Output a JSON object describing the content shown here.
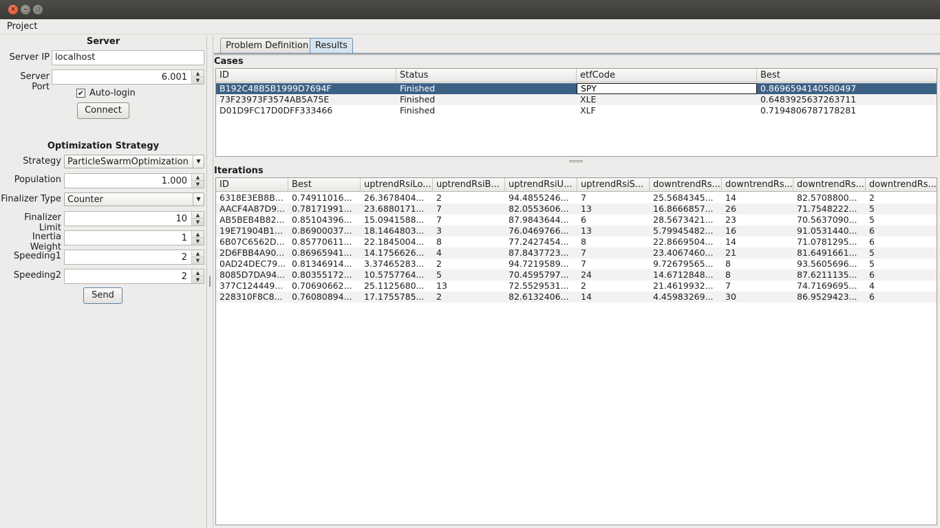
{
  "window": {
    "close_glyph": "×",
    "min_glyph": "–",
    "max_glyph": "▫"
  },
  "menu": {
    "project": "Project"
  },
  "server": {
    "title": "Server",
    "ip_label": "Server IP",
    "ip_value": "localhost",
    "port_label": "Server Port",
    "port_value": "6.001",
    "autologin_label": "Auto-login",
    "autologin_checked": true,
    "connect_label": "Connect"
  },
  "optimization": {
    "title": "Optimization Strategy",
    "strategy_label": "Strategy",
    "strategy_value": "ParticleSwarmOptimization",
    "population_label": "Population",
    "population_value": "1.000",
    "finalizer_type_label": "Finalizer Type",
    "finalizer_type_value": "Counter",
    "finalizer_limit_label": "Finalizer Limit",
    "finalizer_limit_value": "10",
    "inertia_label": "Inertia Weight",
    "inertia_value": "1",
    "speeding1_label": "Speeding1",
    "speeding1_value": "2",
    "speeding2_label": "Speeding2",
    "speeding2_value": "2",
    "send_label": "Send"
  },
  "tabs": {
    "problem_definition": "Problem Definition",
    "results": "Results"
  },
  "cases": {
    "title": "Cases",
    "headers": [
      "ID",
      "Status",
      "etfCode",
      "Best"
    ],
    "rows": [
      [
        "B192C48B5B1999D7694F",
        "Finished",
        "SPY",
        "0.8696594140580497"
      ],
      [
        "73F23973F3574AB5A75E",
        "Finished",
        "XLE",
        "0.6483925637263711"
      ],
      [
        "D01D9FC17D0DFF333466",
        "Finished",
        "XLF",
        "0.7194806787178281"
      ]
    ]
  },
  "iterations": {
    "title": "Iterations",
    "headers": [
      "ID",
      "Best",
      "uptrendRsiLo...",
      "uptrendRsiB...",
      "uptrendRsiU...",
      "uptrendRsiS...",
      "downtrendRs...",
      "downtrendRs...",
      "downtrendRs...",
      "downtrendRs..."
    ],
    "rows": [
      [
        "6318E3EB8B...",
        "0.74911016...",
        "26.3678404...",
        "2",
        "94.4855246...",
        "7",
        "25.5684345...",
        "14",
        "82.5708800...",
        "2"
      ],
      [
        "AACF4A87D9...",
        "0.78171991...",
        "23.6880171...",
        "7",
        "82.0553606...",
        "13",
        "16.8666857...",
        "26",
        "71.7548222...",
        "5"
      ],
      [
        "AB5BEB4B82...",
        "0.85104396...",
        "15.0941588...",
        "7",
        "87.9843644...",
        "6",
        "28.5673421...",
        "23",
        "70.5637090...",
        "5"
      ],
      [
        "19E71904B1...",
        "0.86900037...",
        "18.1464803...",
        "3",
        "76.0469766...",
        "13",
        "5.79945482...",
        "16",
        "91.0531440...",
        "6"
      ],
      [
        "6B07C6562D...",
        "0.85770611...",
        "22.1845004...",
        "8",
        "77.2427454...",
        "8",
        "22.8669504...",
        "14",
        "71.0781295...",
        "6"
      ],
      [
        "2D6FBB4A90...",
        "0.86965941...",
        "14.1756626...",
        "4",
        "87.8437723...",
        "7",
        "23.4067460...",
        "21",
        "81.6491661...",
        "5"
      ],
      [
        "0AD24DEC79...",
        "0.81346914...",
        "3.37465283...",
        "2",
        "94.7219589...",
        "7",
        "9.72679565...",
        "8",
        "93.5605696...",
        "5"
      ],
      [
        "8085D7DA94...",
        "0.80355172...",
        "10.5757764...",
        "5",
        "70.4595797...",
        "24",
        "14.6712848...",
        "8",
        "87.6211135...",
        "6"
      ],
      [
        "377C124449...",
        "0.70690662...",
        "25.1125680...",
        "13",
        "72.5529531...",
        "2",
        "21.4619932...",
        "7",
        "74.7169695...",
        "4"
      ],
      [
        "228310F8C8...",
        "0.76080894...",
        "17.1755785...",
        "2",
        "82.6132406...",
        "14",
        "4.45983269...",
        "30",
        "86.9529423...",
        "6"
      ]
    ]
  },
  "icons": {
    "spin_up": "▲",
    "spin_down": "▼",
    "combo_arrow": "▼",
    "check": "✔"
  },
  "colors": {
    "selection": "#3d6185",
    "active_tab": "#d6e3f0"
  }
}
